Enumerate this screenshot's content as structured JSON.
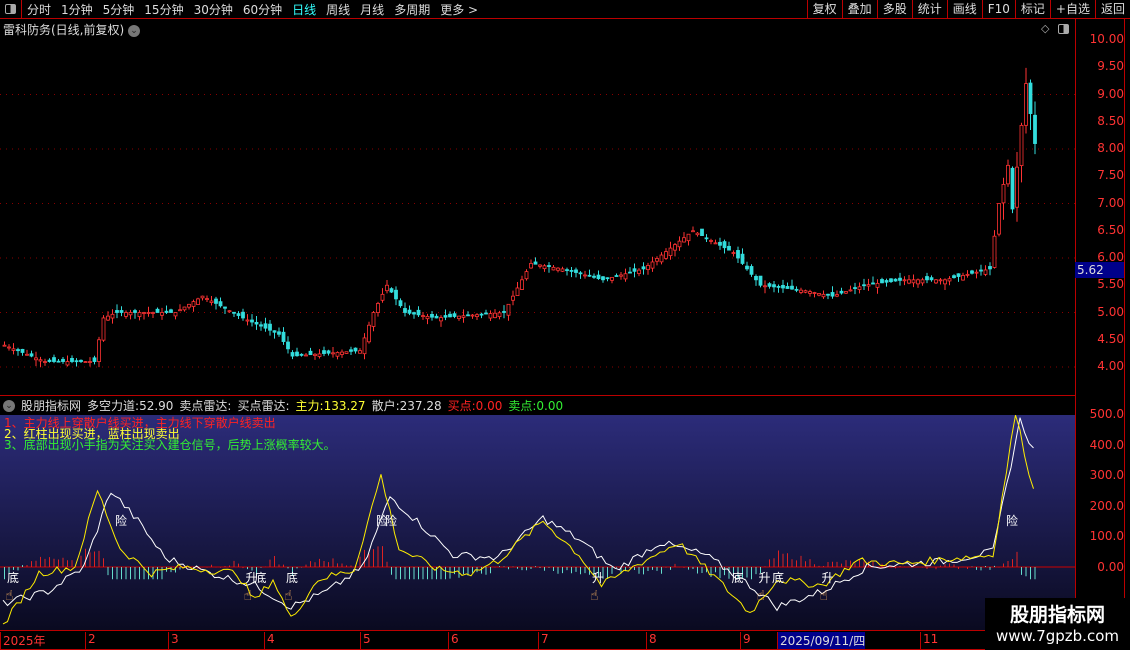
{
  "toolbar": {
    "periods": [
      "分时",
      "1分钟",
      "5分钟",
      "15分钟",
      "30分钟",
      "60分钟",
      "日线",
      "周线",
      "月线",
      "多周期",
      "更多 >"
    ],
    "active": "日线",
    "right": [
      "复权",
      "叠加",
      "多股",
      "统计",
      "画线",
      "F10",
      "标记",
      "+自选",
      "返回"
    ]
  },
  "stock_title": "雷科防务(日线,前复权)",
  "price_axis": {
    "labels": [
      "10.00",
      "9.50",
      "9.00",
      "8.50",
      "8.00",
      "7.50",
      "7.00",
      "6.50",
      "6.00",
      "5.50",
      "5.00",
      "4.50",
      "4.00"
    ],
    "current": "5.62"
  },
  "indicator": {
    "name": "股朋指标网",
    "fields": [
      {
        "label": "多空力道:",
        "value": "52.90",
        "color": "#dddddd"
      },
      {
        "label": "卖点雷达:",
        "value": "",
        "color": "#dddddd"
      },
      {
        "label": "买点雷达:",
        "value": "",
        "color": "#dddddd"
      },
      {
        "label": "主力:",
        "value": "133.27",
        "color": "#ffff33"
      },
      {
        "label": "散户:",
        "value": "237.28",
        "color": "#dddddd"
      },
      {
        "label": "买点:",
        "value": "0.00",
        "color": "#ff2222"
      },
      {
        "label": "卖点:",
        "value": "0.00",
        "color": "#33ee33"
      }
    ],
    "notes": [
      "1、主力线上穿散户线买进，主力线下穿散户线卖出",
      "2、红柱出现买进，蓝柱出现卖出",
      "3、底部出现小手指为关注买入建仓信号，后势上涨概率较大。"
    ],
    "axis": [
      "500.0",
      "400.0",
      "300.0",
      "200.0",
      "100.0",
      "0.00"
    ]
  },
  "date_axis": [
    "2025年",
    "2",
    "3",
    "4",
    "5",
    "6",
    "7",
    "8",
    "9",
    "2025/09/11/四",
    "11"
  ],
  "watermark": {
    "name": "股朋指标网",
    "url": "www.7gpzb.com"
  },
  "chart_data": {
    "type": "candlestick",
    "candles": 230,
    "price_keyframes": [
      [
        0,
        4.4
      ],
      [
        9,
        4.1
      ],
      [
        20,
        4.1
      ],
      [
        22,
        4.9
      ],
      [
        25,
        5.0
      ],
      [
        38,
        5.0
      ],
      [
        44,
        5.3
      ],
      [
        53,
        4.9
      ],
      [
        61,
        4.6
      ],
      [
        64,
        4.2
      ],
      [
        79,
        4.3
      ],
      [
        82,
        5.0
      ],
      [
        85,
        5.5
      ],
      [
        89,
        5.0
      ],
      [
        96,
        4.9
      ],
      [
        111,
        5.0
      ],
      [
        117,
        5.9
      ],
      [
        124,
        5.8
      ],
      [
        133,
        5.6
      ],
      [
        142,
        5.8
      ],
      [
        153,
        6.5
      ],
      [
        162,
        6.1
      ],
      [
        168,
        5.5
      ],
      [
        178,
        5.4
      ],
      [
        184,
        5.3
      ],
      [
        191,
        5.5
      ],
      [
        200,
        5.6
      ],
      [
        209,
        5.6
      ],
      [
        219,
        5.8
      ],
      [
        221,
        7.0
      ],
      [
        223,
        7.7
      ],
      [
        224,
        6.9
      ],
      [
        227,
        9.2
      ],
      [
        229,
        8.1
      ],
      [
        231,
        9.3
      ],
      [
        234,
        9.0
      ]
    ],
    "zhuli_keyframes": [
      [
        0,
        -190
      ],
      [
        8,
        -20
      ],
      [
        16,
        0
      ],
      [
        21,
        250
      ],
      [
        26,
        60
      ],
      [
        33,
        -20
      ],
      [
        40,
        0
      ],
      [
        52,
        -20
      ],
      [
        56,
        -110
      ],
      [
        60,
        -40
      ],
      [
        64,
        -170
      ],
      [
        70,
        -40
      ],
      [
        78,
        -10
      ],
      [
        84,
        300
      ],
      [
        88,
        60
      ],
      [
        97,
        -10
      ],
      [
        104,
        -20
      ],
      [
        110,
        20
      ],
      [
        120,
        150
      ],
      [
        128,
        40
      ],
      [
        133,
        -60
      ],
      [
        140,
        0
      ],
      [
        150,
        80
      ],
      [
        158,
        -30
      ],
      [
        166,
        -150
      ],
      [
        172,
        -40
      ],
      [
        182,
        -60
      ],
      [
        190,
        20
      ],
      [
        200,
        10
      ],
      [
        212,
        30
      ],
      [
        220,
        40
      ],
      [
        225,
        500
      ],
      [
        229,
        250
      ],
      [
        232,
        90
      ],
      [
        234,
        120
      ]
    ],
    "sanhu_keyframes": [
      [
        0,
        -120
      ],
      [
        10,
        -80
      ],
      [
        18,
        0
      ],
      [
        24,
        250
      ],
      [
        30,
        150
      ],
      [
        36,
        30
      ],
      [
        46,
        -20
      ],
      [
        56,
        -60
      ],
      [
        64,
        -130
      ],
      [
        72,
        -80
      ],
      [
        80,
        0
      ],
      [
        86,
        230
      ],
      [
        92,
        150
      ],
      [
        100,
        40
      ],
      [
        110,
        30
      ],
      [
        120,
        160
      ],
      [
        128,
        90
      ],
      [
        136,
        -10
      ],
      [
        146,
        80
      ],
      [
        156,
        40
      ],
      [
        166,
        -60
      ],
      [
        172,
        -130
      ],
      [
        182,
        -80
      ],
      [
        192,
        0
      ],
      [
        210,
        20
      ],
      [
        220,
        50
      ],
      [
        226,
        480
      ],
      [
        230,
        350
      ],
      [
        234,
        260
      ]
    ],
    "signals": [
      {
        "i": 2,
        "text": "底",
        "finger": true
      },
      {
        "i": 55,
        "text": "升",
        "finger": true
      },
      {
        "i": 57,
        "text": "底"
      },
      {
        "i": 64,
        "text": "底",
        "finger": true
      },
      {
        "i": 26,
        "text": "险"
      },
      {
        "i": 84,
        "text": "险"
      },
      {
        "i": 86,
        "text": "险"
      },
      {
        "i": 132,
        "text": "升",
        "finger": true
      },
      {
        "i": 163,
        "text": "底"
      },
      {
        "i": 169,
        "text": "升",
        "finger": true
      },
      {
        "i": 172,
        "text": "底"
      },
      {
        "i": 183,
        "text": "升",
        "finger": true
      },
      {
        "i": 224,
        "text": "险"
      }
    ]
  }
}
